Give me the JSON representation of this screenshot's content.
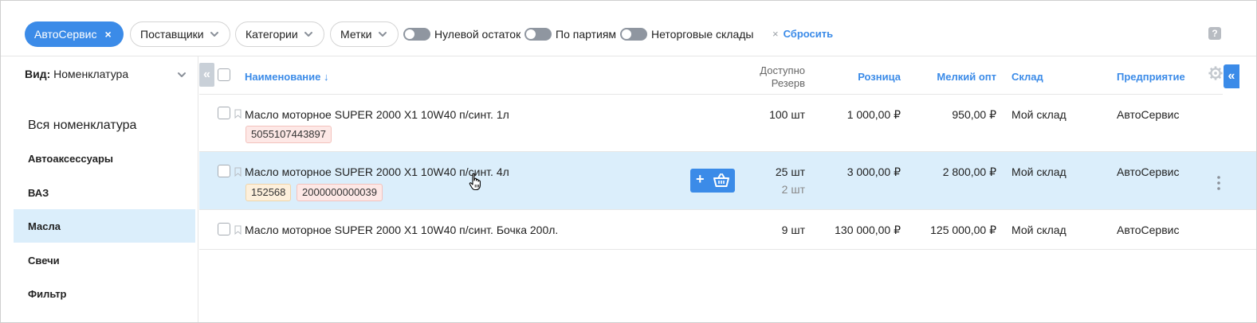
{
  "filters": {
    "active_chip": "АвтоСервис",
    "active_chip_close": "×",
    "dropdowns": [
      {
        "label": "Поставщики"
      },
      {
        "label": "Категории"
      },
      {
        "label": "Метки"
      }
    ],
    "toggles": [
      {
        "label": "Нулевой остаток",
        "on": false
      },
      {
        "label": "По партиям",
        "on": false
      },
      {
        "label": "Неторговые склады",
        "on": false
      }
    ],
    "reset_icon": "×",
    "reset_label": "Сбросить",
    "help": "?"
  },
  "sidebar": {
    "view_label": "Вид:",
    "view_value": "Номенклатура",
    "items": [
      {
        "label": "Вся номенклатура"
      },
      {
        "label": "Автоаксессуары"
      },
      {
        "label": "ВАЗ"
      },
      {
        "label": "Масла",
        "selected": true
      },
      {
        "label": "Свечи"
      },
      {
        "label": "Фильтр"
      }
    ]
  },
  "table": {
    "collapse_left": "«",
    "collapse_right": "«",
    "headers": {
      "name": "Наименование ↓",
      "available": "Доступно",
      "reserve": "Резерв",
      "retail": "Розница",
      "wholesale": "Мелкий опт",
      "warehouse": "Склад",
      "company": "Предприятие"
    },
    "rows": [
      {
        "name": "Масло моторное SUPER 2000 X1 10W40 п/синт. 1л",
        "tags": [
          {
            "text": "5055107443897",
            "color": "red"
          }
        ],
        "available": "100 шт",
        "reserve": "",
        "retail": "1 000,00 ₽",
        "wholesale": "950,00 ₽",
        "warehouse": "Мой склад",
        "company": "АвтоСервис"
      },
      {
        "name": "Масло моторное SUPER 2000 X1 10W40 п/синт. 4л",
        "tags": [
          {
            "text": "152568",
            "color": "yellow"
          },
          {
            "text": "2000000000039",
            "color": "red"
          }
        ],
        "available": "25 шт",
        "reserve": "2 шт",
        "retail": "3 000,00 ₽",
        "wholesale": "2 800,00 ₽",
        "warehouse": "Мой склад",
        "company": "АвтоСервис",
        "highlighted": true,
        "action_plus": "+"
      },
      {
        "name": "Масло моторное SUPER 2000 X1 10W40 п/синт. Бочка 200л.",
        "tags": [],
        "available": "9 шт",
        "reserve": "",
        "retail": "130 000,00 ₽",
        "wholesale": "125 000,00 ₽",
        "warehouse": "Мой склад",
        "company": "АвтоСервис"
      }
    ]
  },
  "colors": {
    "accent": "#3b8be8",
    "row_highlight": "#dbeefb",
    "tag_red": "#fde8e6",
    "tag_yellow": "#fdf0dc"
  },
  "icons": [
    "close-icon",
    "chevron-down-icon",
    "toggle-switch",
    "help-icon",
    "collapse-left-icon",
    "collapse-right-icon",
    "gear-icon",
    "bookmark-icon",
    "plus-icon",
    "basket-icon",
    "kebab-menu-icon",
    "hand-cursor-icon"
  ]
}
